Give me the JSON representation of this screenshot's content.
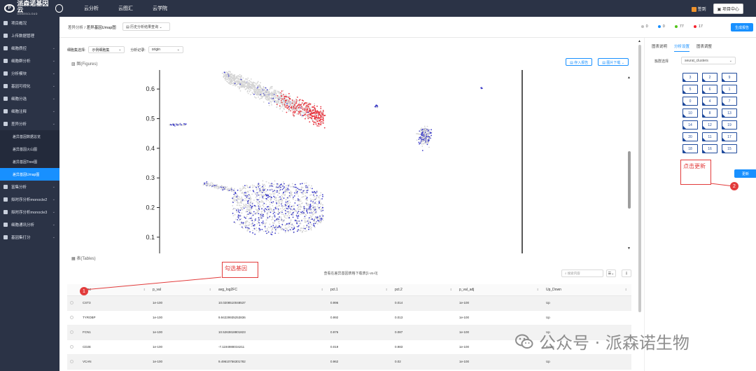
{
  "topbar": {
    "logo_cn": "派森诺基因云",
    "logo_en": "GENESCLOUD",
    "nav": [
      "云分析",
      "云图汇",
      "云学院"
    ],
    "notice": "签到",
    "project_center": "项目中心"
  },
  "sidebar": {
    "items": [
      {
        "label": "项目概况",
        "chev": false
      },
      {
        "label": "上传数据管理",
        "chev": false
      },
      {
        "label": "细胞质控",
        "chev": true
      },
      {
        "label": "细胞群分析",
        "chev": true
      },
      {
        "label": "分析模块",
        "chev": true
      },
      {
        "label": "基因可视化",
        "chev": true
      },
      {
        "label": "细胞分选",
        "chev": true
      },
      {
        "label": "细胞注释",
        "chev": true
      },
      {
        "label": "差异分析",
        "chev": true
      }
    ],
    "sub_items": [
      "差异基因数据总览",
      "差异基因火山图",
      "差异基因Tree图",
      "差异基因Umap图"
    ],
    "items_after": [
      {
        "label": "富集分析",
        "chev": true
      },
      {
        "label": "拟时序分析monocle2",
        "chev": true
      },
      {
        "label": "拟时序分析monocle3",
        "chev": true
      },
      {
        "label": "细胞通讯分析",
        "chev": true
      },
      {
        "label": "基因集打分",
        "chev": true
      }
    ]
  },
  "crumbbar": {
    "crumb_parent": "差异分析",
    "crumb_sep": " / ",
    "crumb_current": "差异基因Umap图",
    "select_value": "历史分析结果查询",
    "statuses": [
      {
        "count": "0",
        "color": "#bfbfbf"
      },
      {
        "count": "0",
        "color": "#1890ff"
      },
      {
        "count": "77",
        "color": "#52c41a"
      },
      {
        "count": "17",
        "color": "#f5222d"
      }
    ],
    "generate_label": "生成报告"
  },
  "params": {
    "group_label": "细胞集选择:",
    "group_value": "示例细胞集",
    "record_label": "分析记录:",
    "record_value": "origin"
  },
  "figure": {
    "title": "图(Figures)",
    "btn_save": "存入报告",
    "btn_download": "图片下载"
  },
  "chart_data": {
    "type": "scatter",
    "y_ticks": [
      "0.6",
      "0.5",
      "0.4",
      "0.3",
      "0.2",
      "0.1"
    ],
    "ylim": [
      0.05,
      0.65
    ],
    "colors": {
      "low": "#d5d5d5",
      "high": "#e8323c",
      "neg": "#3b3bc8"
    }
  },
  "tables": {
    "title": "表(Tables)",
    "caption": "查看在差异基因表格下载表[1-vs-0]",
    "search_placeholder": "搜索内容",
    "columns": [
      "Gene",
      "p_val",
      "avg_log2FC",
      "pct.1",
      "pct.2",
      "p_val_adj",
      "Up_Down"
    ],
    "rows": [
      [
        "CST3",
        "1e-100",
        "10.0208510048537",
        "0.996",
        "0.014",
        "1e-100",
        "Up"
      ],
      [
        "TYROBP",
        "1e-100",
        "9.94229935253836",
        "0.992",
        "0.013",
        "1e-100",
        "Up"
      ],
      [
        "FCN1",
        "1e-100",
        "10.5263818801823",
        "0.976",
        "0.087",
        "1e-100",
        "Up"
      ],
      [
        "CD2E",
        "1e-100",
        "-7.1194988034211",
        "0.019",
        "0.983",
        "1e-100",
        "Down"
      ],
      [
        "VCAN",
        "1e-100",
        "9.49610756301782",
        "0.962",
        "0.02",
        "1e-100",
        "Up"
      ]
    ]
  },
  "right_panel": {
    "tabs": [
      "图表说明",
      "分析设置",
      "图表调整"
    ],
    "active_tab": 1,
    "group_label": "簇群选择",
    "group_value": "seurat_clusters",
    "clusters": [
      "3",
      "2",
      "9",
      "5",
      "6",
      "1",
      "0",
      "4",
      "7",
      "10",
      "8",
      "13",
      "14",
      "12",
      "19",
      "20",
      "11",
      "17",
      "18",
      "16",
      "15"
    ],
    "update_label": "更新"
  },
  "annotations": {
    "box1": "勾选基因",
    "box2": "点击更新",
    "badge1": "1",
    "badge2": "2"
  },
  "watermark": {
    "text": "公众号 · 派森诺生物"
  }
}
